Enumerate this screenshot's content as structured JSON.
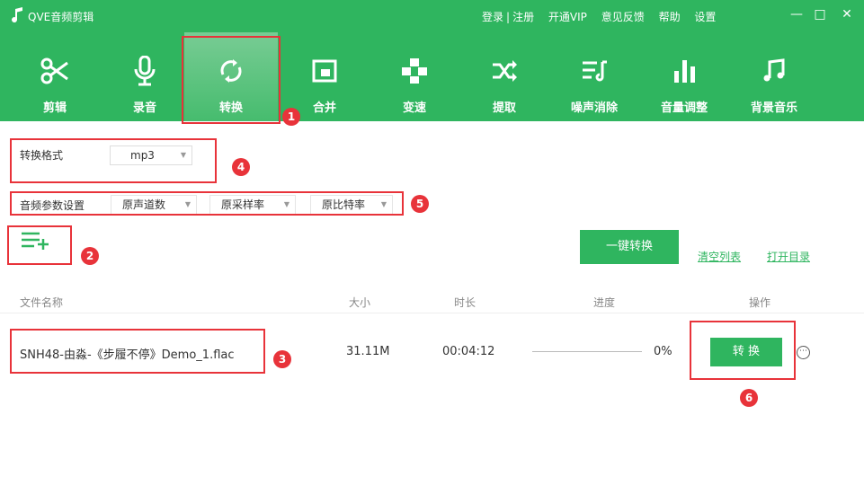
{
  "app": {
    "title": "QVE音频剪辑"
  },
  "header_links": {
    "login": "登录",
    "sep": "|",
    "register": "注册",
    "vip": "开通VIP",
    "feedback": "意见反馈",
    "help": "帮助",
    "settings": "设置"
  },
  "window_controls": {
    "minimize": "—",
    "maximize": "□",
    "close": "✕"
  },
  "toolbar": {
    "items": [
      {
        "label": "剪辑",
        "icon": "scissors-icon"
      },
      {
        "label": "录音",
        "icon": "microphone-icon"
      },
      {
        "label": "转换",
        "icon": "convert-icon"
      },
      {
        "label": "合并",
        "icon": "merge-icon"
      },
      {
        "label": "变速",
        "icon": "speed-icon"
      },
      {
        "label": "提取",
        "icon": "extract-icon"
      },
      {
        "label": "噪声消除",
        "icon": "noise-icon"
      },
      {
        "label": "音量调整",
        "icon": "volume-icon"
      },
      {
        "label": "背景音乐",
        "icon": "music-icon"
      }
    ],
    "active": "转换"
  },
  "format": {
    "label": "转换格式",
    "value": "mp3"
  },
  "params": {
    "label": "音频参数设置",
    "channels": "原声道数",
    "sample_rate": "原采样率",
    "bitrate": "原比特率"
  },
  "actions": {
    "convert_all": "一键转换",
    "clear_list": "清空列表",
    "open_dir": "打开目录"
  },
  "table": {
    "headers": {
      "name": "文件名称",
      "size": "大小",
      "duration": "时长",
      "progress": "进度",
      "ops": "操作"
    },
    "rows": [
      {
        "name": "SNH48-由淼-《步履不停》Demo_1.flac",
        "size": "31.11M",
        "duration": "00:04:12",
        "progress": "0%",
        "action": "转 换",
        "more": "⋯"
      }
    ]
  },
  "annotations": [
    "1",
    "2",
    "3",
    "4",
    "5",
    "6"
  ],
  "colors": {
    "brand": "#2fb55f",
    "annotation": "#e8333a"
  }
}
